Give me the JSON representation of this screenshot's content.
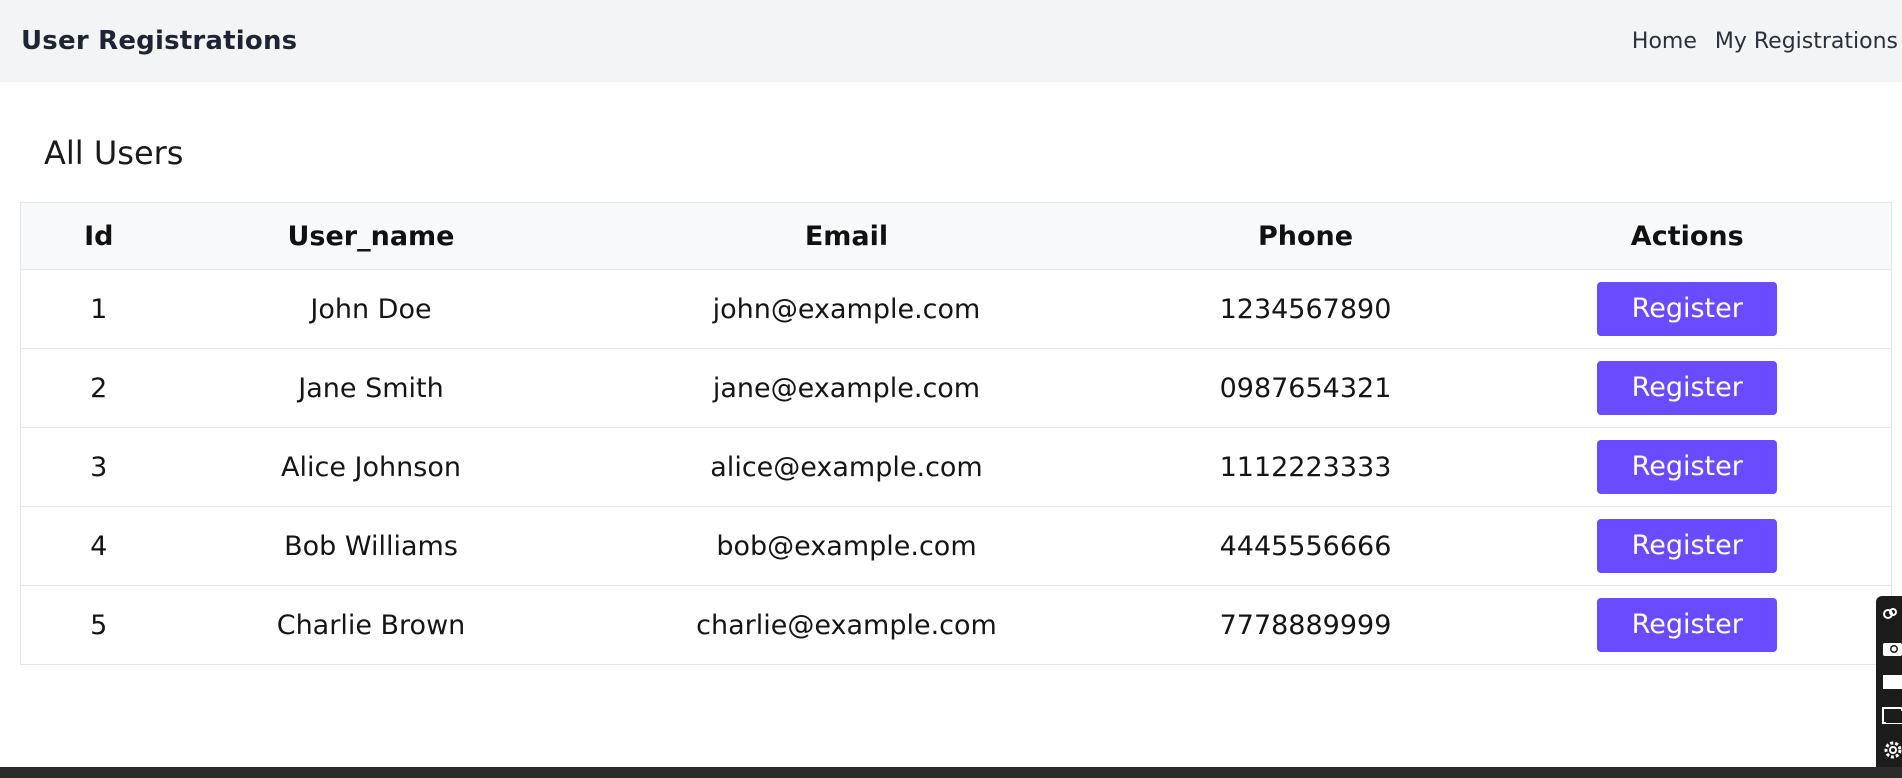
{
  "navbar": {
    "brand": "User Registrations",
    "links": [
      {
        "label": "Home"
      },
      {
        "label": "My Registrations"
      }
    ]
  },
  "page": {
    "title": "All Users"
  },
  "table": {
    "headers": [
      "Id",
      "User_name",
      "Email",
      "Phone",
      "Actions"
    ],
    "rows": [
      {
        "id": "1",
        "user_name": "John Doe",
        "email": "john@example.com",
        "phone": "1234567890",
        "action": "Register"
      },
      {
        "id": "2",
        "user_name": "Jane Smith",
        "email": "jane@example.com",
        "phone": "0987654321",
        "action": "Register"
      },
      {
        "id": "3",
        "user_name": "Alice Johnson",
        "email": "alice@example.com",
        "phone": "1112223333",
        "action": "Register"
      },
      {
        "id": "4",
        "user_name": "Bob Williams",
        "email": "bob@example.com",
        "phone": "4445556666",
        "action": "Register"
      },
      {
        "id": "5",
        "user_name": "Charlie Brown",
        "email": "charlie@example.com",
        "phone": "7778889999",
        "action": "Register"
      }
    ]
  },
  "colors": {
    "navbar_bg": "#f3f4f6",
    "button_bg": "#6a4bff",
    "button_text": "#ffffff",
    "table_header_bg": "#f8f9fb"
  },
  "side_toolbar": {
    "icons": [
      "link-icon",
      "camera-icon",
      "square-icon",
      "window-icon",
      "gear-icon"
    ]
  }
}
